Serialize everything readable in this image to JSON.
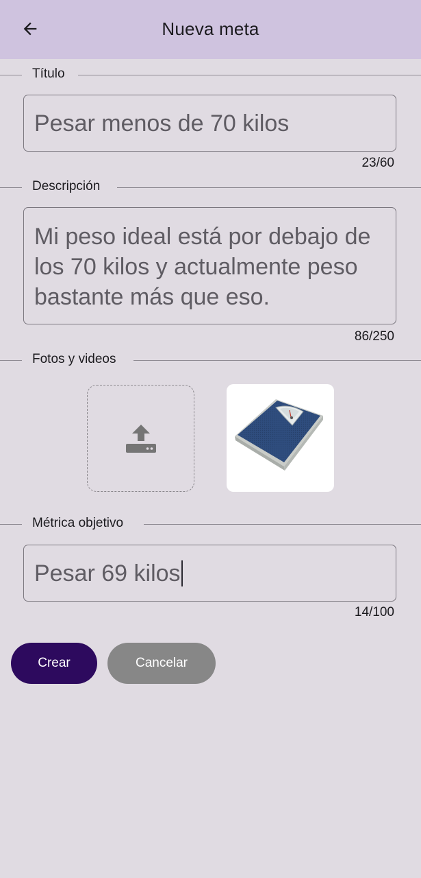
{
  "header": {
    "title": "Nueva meta",
    "back_icon": "arrow-back-icon"
  },
  "title_section": {
    "label": "Título",
    "value": "Pesar menos de 70 kilos",
    "counter": "23/60"
  },
  "description_section": {
    "label": "Descripción",
    "value": "Mi peso ideal está por debajo de los 70 kilos y actualmente peso bastante más que eso.",
    "counter": "86/250"
  },
  "media_section": {
    "label": "Fotos y videos",
    "upload_icon": "upload-icon",
    "thumbnail": "bathroom-scale-photo"
  },
  "metric_section": {
    "label": "Métrica objetivo",
    "value": "Pesar 69 kilos",
    "counter": "14/100"
  },
  "actions": {
    "create_label": "Crear",
    "cancel_label": "Cancelar"
  },
  "colors": {
    "appbar": "#cfc3df",
    "background": "#e0dbe2",
    "primary_button": "#2d0a5e",
    "secondary_button": "#878787"
  }
}
